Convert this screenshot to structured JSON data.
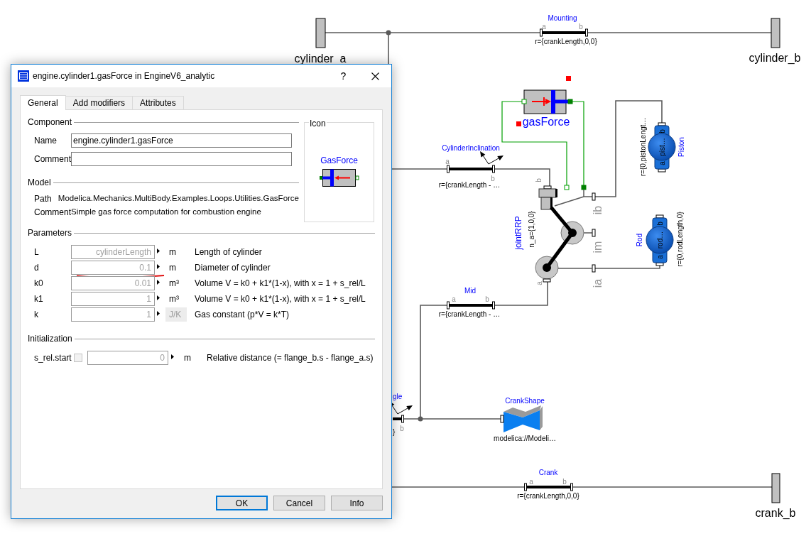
{
  "diagram": {
    "fixed": [
      {
        "label": "cylinder_a"
      },
      {
        "label": "cylinder_b"
      },
      {
        "label": "crank_b"
      }
    ],
    "bars": [
      {
        "kind": "translation",
        "name": "Mounting",
        "port_a": "a",
        "port_b": "b",
        "parameter": "r={crankLength,0,0}"
      },
      {
        "kind": "rotation",
        "name": "CylinderInclination",
        "port_a": "a",
        "port_b": "b",
        "parameter": "r={crankLength - …"
      },
      {
        "kind": "translation",
        "name": "Mid",
        "port_a": "a",
        "port_b": "b",
        "parameter": "r={crankLength - …"
      },
      {
        "kind": "translation",
        "name": "Crank",
        "port_a": "a",
        "port_b": "b",
        "parameter": "r={crankLength,0,0}"
      }
    ],
    "cut_off": {
      "kind": "rotation",
      "name": "gle",
      "port_b": "b",
      "parameter": "}"
    },
    "gas_force": {
      "name": "gasForce",
      "selected": true
    },
    "joint": {
      "name": "jointRRP",
      "parameter": "n_a={1,0,0}",
      "port_b": "b",
      "port_a": "a",
      "ports": [
        "ib",
        "im",
        "ia"
      ]
    },
    "bodies": [
      {
        "name": "Piston",
        "inner": "pist…",
        "port_a": "a",
        "port_b": "b",
        "parameter": "r={0,pistonLengt…"
      },
      {
        "name": "Rod",
        "inner": "rod…",
        "port_a": "a",
        "port_b": "b",
        "parameter": "r={0,rodLength,0}"
      }
    ],
    "crank_shape": {
      "name": "CrankShape",
      "parameter": "modelica://Modeli…"
    }
  },
  "dialog": {
    "title": "engine.cylinder1.gasForce in EngineV6_analytic",
    "help": "?",
    "tabs": [
      {
        "label": "General",
        "selected": true
      },
      {
        "label": "Add modifiers",
        "selected": false
      },
      {
        "label": "Attributes",
        "selected": false
      }
    ],
    "component": {
      "heading": "Component",
      "fields": [
        {
          "label": "Name",
          "value": "engine.cylinder1.gasForce"
        },
        {
          "label": "Comment"
        }
      ]
    },
    "model": {
      "heading": "Model",
      "rows": [
        {
          "label": "Path",
          "value": "Modelica.Mechanics.MultiBody.Examples.Loops.Utilities.GasForce"
        },
        {
          "label": "Comment",
          "value": "Simple gas force computation for combustion engine"
        }
      ]
    },
    "icon": {
      "heading": "Icon",
      "name": "GasForce"
    },
    "parameters": {
      "heading": "Parameters",
      "rows": [
        {
          "name": "L",
          "placeholder": "cylinderLength",
          "unit": "m",
          "unit_box": false,
          "description": "Length of cylinder",
          "marked": false
        },
        {
          "name": "d",
          "placeholder": "0.1",
          "unit": "m",
          "unit_box": false,
          "description": "Diameter of cylinder",
          "marked": true
        },
        {
          "name": "k0",
          "placeholder": "0.01",
          "unit": "m³",
          "unit_box": false,
          "description": "Volume V = k0 + k1*(1-x), with x = 1 + s_rel/L",
          "marked": false
        },
        {
          "name": "k1",
          "placeholder": "1",
          "unit": "m³",
          "unit_box": false,
          "description": "Volume V = k0 + k1*(1-x), with x = 1 + s_rel/L",
          "marked": false
        },
        {
          "name": "k",
          "placeholder": "1",
          "unit": "J/K",
          "unit_box": true,
          "description": "Gas constant (p*V = k*T)",
          "marked": false
        }
      ]
    },
    "initialization": {
      "heading": "Initialization",
      "rows": [
        {
          "name": "s_rel.start",
          "checked": false,
          "disabled": true,
          "placeholder": "0",
          "unit": "m",
          "description": "Relative distance (= flange_b.s - flange_a.s)"
        }
      ]
    },
    "buttons": [
      {
        "label": "OK",
        "default": true
      },
      {
        "label": "Cancel",
        "default": false
      },
      {
        "label": "Info",
        "default": false
      }
    ]
  }
}
